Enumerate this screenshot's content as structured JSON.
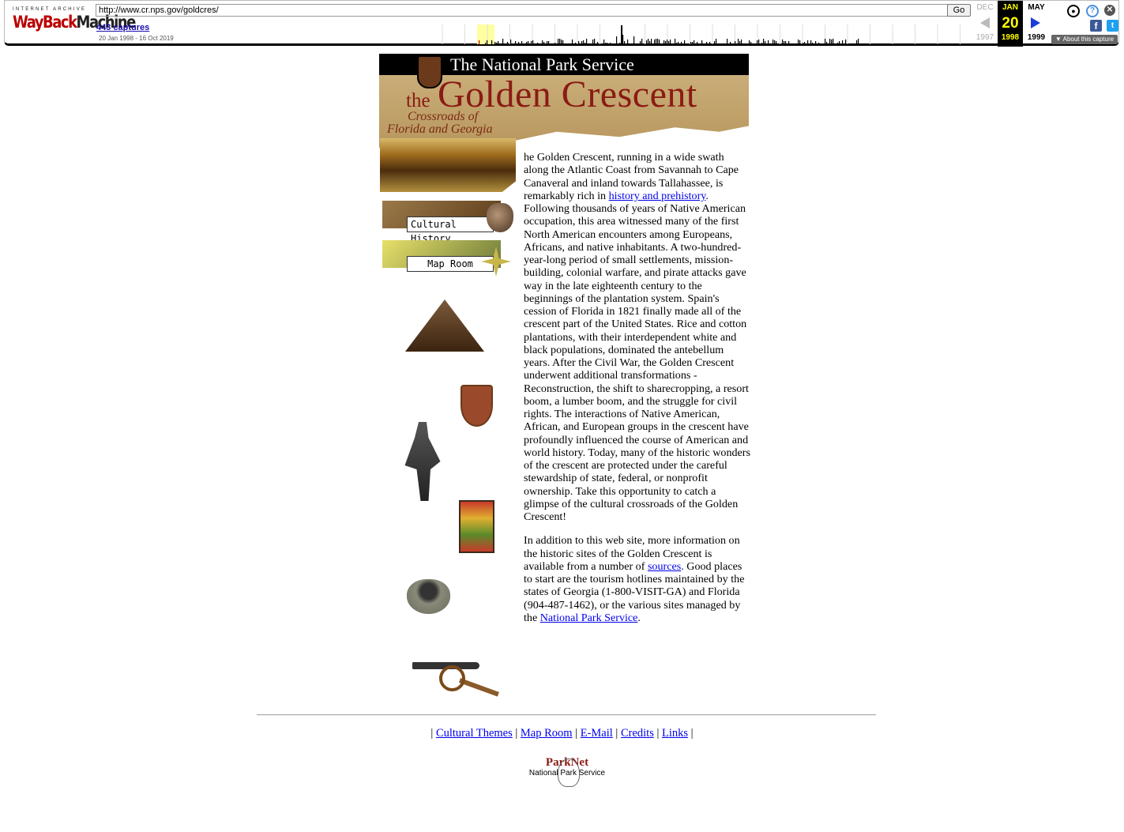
{
  "wayback": {
    "logo_top": "INTERNET ARCHIVE",
    "logo_way": "WayBack",
    "logo_machine": "Machine",
    "url": "http://www.cr.nps.gov/goldcres/",
    "go_label": "Go",
    "captures": "443 captures",
    "range": "20 Jan 1998 - 16 Oct 2019",
    "prev": {
      "month": "DEC",
      "year": "1997"
    },
    "current": {
      "month": "JAN",
      "day": "20",
      "year": "1998"
    },
    "next": {
      "month": "MAY",
      "year": "1999"
    },
    "about": "▼ About this capture",
    "icons": [
      "user-icon",
      "help-icon",
      "close-icon",
      "facebook-icon",
      "twitter-icon"
    ]
  },
  "banner": {
    "agency": "The National Park Service",
    "the": "the",
    "title": "Golden Crescent",
    "subtitle_1": "Crossroads of",
    "subtitle_2": "Florida and Georgia"
  },
  "nav_buttons": {
    "cultural_history": "Cultural History",
    "map_room": "Map Room"
  },
  "body": {
    "p1_a": "he Golden Crescent, running in a wide swath along the Atlantic Coast from Savannah to Cape Canaveral and inland towards Tallahassee, is remarkably rich in ",
    "p1_link": "history and prehistory",
    "p1_b": ". Following thousands of years of Native American occupation, this area witnessed many of the first North American encounters among Europeans, Africans, and native inhabitants. A two-hundred-year-long period of small settlements, mission-building, colonial warfare, and pirate attacks gave way in the late eighteenth century to the beginnings of the plantation system. Spain's cession of Florida in 1821 finally made all of the crescent part of the United States. Rice and cotton plantations, with their interdependent white and black populations, dominated the antebellum years. After the Civil War, the Golden Crescent underwent additional transformations - Reconstruction, the shift to sharecropping, a resort boom, a lumber boom, and the struggle for civil rights. The interactions of Native American, African, and European groups in the crescent have profoundly influenced the course of American and world history. Today, many of the historic wonders of the crescent are protected under the careful stewardship of state, federal, or nonprofit ownership. Take this opportunity to catch a glimpse of the cultural crossroads of the Golden Crescent!",
    "p2_a": "In addition to this web site, more information on the historic sites of the Golden Crescent is available from a number of ",
    "p2_link1": "sources",
    "p2_b": ". Good places to start are the tourism hotlines maintained by the states of Georgia (1-800-VISIT-GA) and Florida (904-487-1462), or the various sites managed by the ",
    "p2_link2": "National Park Service",
    "p2_c": "."
  },
  "footer": {
    "links": [
      "Cultural Themes",
      "Map Room",
      "E-Mail",
      "Credits",
      "Links"
    ],
    "sep": "|",
    "parknet": "ParkNet",
    "nps": "National Park Service"
  },
  "colors": {
    "wayback_red": "#bb0000",
    "title_red": "#8b1a14",
    "link": "#0000ee",
    "current_highlight": "#ffff00"
  }
}
